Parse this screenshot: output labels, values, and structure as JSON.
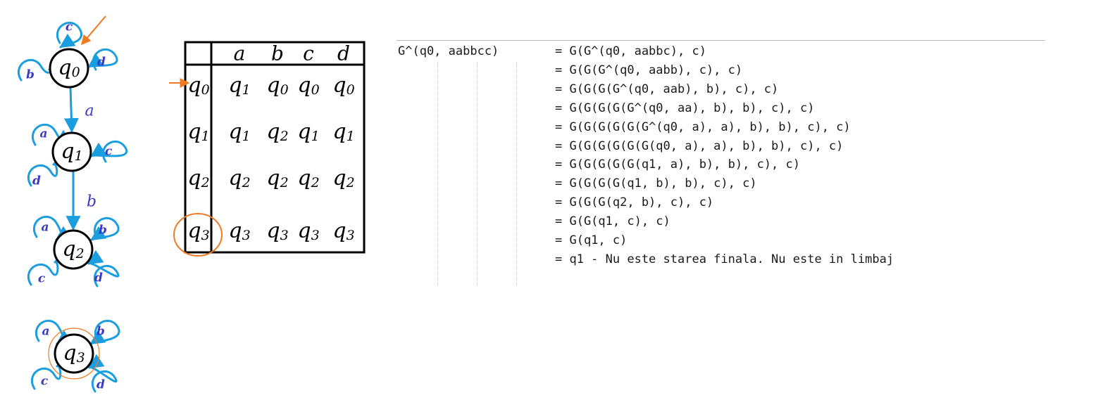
{
  "diagram": {
    "states": [
      {
        "id": "q0",
        "label": "q0",
        "initial": true,
        "final": false,
        "self_loops": [
          "c",
          "b",
          "d"
        ]
      },
      {
        "id": "q1",
        "label": "q1",
        "initial": false,
        "final": false,
        "self_loops": [
          "a",
          "c",
          "d"
        ]
      },
      {
        "id": "q2",
        "label": "q2",
        "initial": false,
        "final": false,
        "self_loops": [
          "a",
          "b",
          "c",
          "d"
        ]
      },
      {
        "id": "q3",
        "label": "q3",
        "initial": false,
        "final": true,
        "self_loops": [
          "a",
          "b",
          "c",
          "d"
        ]
      }
    ],
    "transitions": [
      {
        "from": "q0",
        "to": "q1",
        "label": "a"
      },
      {
        "from": "q1",
        "to": "q2",
        "label": "b"
      }
    ],
    "colors": {
      "edge": "#1a9ee0",
      "letter": "#3a3ac8",
      "accent": "#f07a22",
      "ink": "#000000"
    }
  },
  "table": {
    "columns": [
      "a",
      "b",
      "c",
      "d"
    ],
    "rows": [
      {
        "state": "q0",
        "cells": [
          "q1",
          "q0",
          "q0",
          "q0"
        ],
        "marker": "arrow"
      },
      {
        "state": "q1",
        "cells": [
          "q1",
          "q2",
          "q1",
          "q1"
        ],
        "marker": ""
      },
      {
        "state": "q2",
        "cells": [
          "q2",
          "q2",
          "q2",
          "q2"
        ],
        "marker": ""
      },
      {
        "state": "q3",
        "cells": [
          "q3",
          "q3",
          "q3",
          "q3"
        ],
        "marker": "circle"
      }
    ]
  },
  "derivation": {
    "lhs": "G^(q0, aabbcc)",
    "lines": [
      "= G(G^(q0, aabbc), c)",
      "= G(G(G^(q0, aabb), c), c)",
      "= G(G(G(G^(q0, aab), b), c), c)",
      "= G(G(G(G(G^(q0, aa), b), b), c), c)",
      "= G(G(G(G(G(G^(q0, a), a), b), b), c), c)",
      "= G(G(G(G(G(G(q0, a), a), b), b), c), c)",
      "= G(G(G(G(G(q1, a), b), b), c), c)",
      "= G(G(G(G(q1, b), b), c), c)",
      "= G(G(G(q2, b), c), c)",
      "= G(G(q1, c), c)",
      "= G(q1, c)",
      "= q1 - Nu este starea finala. Nu este in limbaj"
    ]
  }
}
